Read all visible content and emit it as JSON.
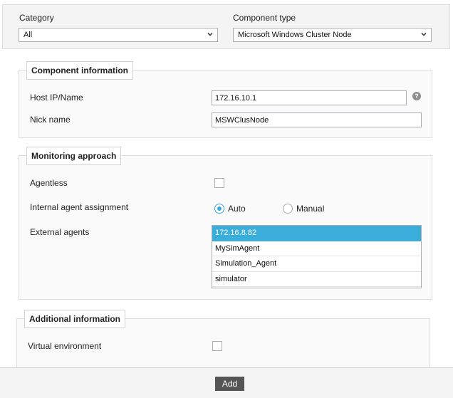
{
  "filters": {
    "category": {
      "label": "Category",
      "value": "All"
    },
    "component_type": {
      "label": "Component type",
      "value": "Microsoft Windows Cluster Node"
    }
  },
  "component_information": {
    "legend": "Component information",
    "host": {
      "label": "Host IP/Name",
      "value": "172.16.10.1",
      "help_icon": "question-circle-icon",
      "help_glyph": "?"
    },
    "nick_name": {
      "label": "Nick name",
      "value": "MSWClusNode"
    }
  },
  "monitoring_approach": {
    "legend": "Monitoring approach",
    "agentless": {
      "label": "Agentless",
      "checked": false
    },
    "internal_agent_assignment": {
      "label": "Internal agent assignment",
      "options": [
        {
          "label": "Auto",
          "checked": true
        },
        {
          "label": "Manual",
          "checked": false
        }
      ]
    },
    "external_agents": {
      "label": "External agents",
      "items": [
        {
          "label": "172.16.8.82",
          "selected": true
        },
        {
          "label": "MySimAgent",
          "selected": false
        },
        {
          "label": "Simulation_Agent",
          "selected": false
        },
        {
          "label": "simulator",
          "selected": false
        }
      ]
    }
  },
  "additional_information": {
    "legend": "Additional information",
    "virtual_environment": {
      "label": "Virtual environment",
      "checked": false
    }
  },
  "footer": {
    "add_label": "Add"
  },
  "colors": {
    "accent": "#3aaddb",
    "button": "#555555"
  }
}
